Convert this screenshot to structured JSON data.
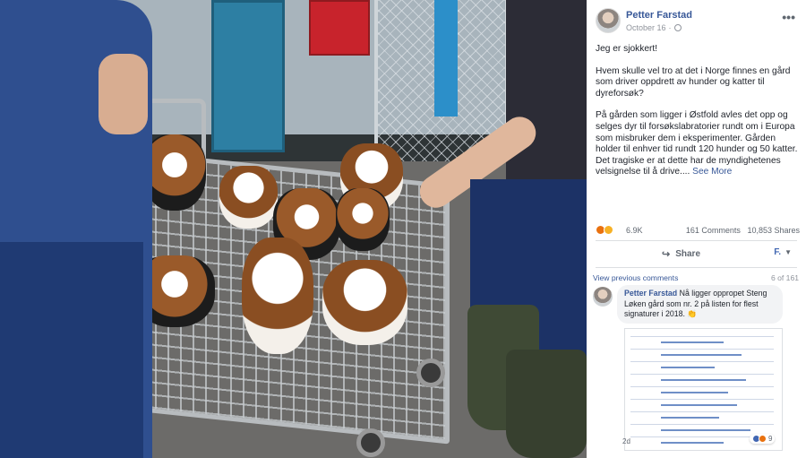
{
  "post": {
    "author": "Petter Farstad",
    "date": "October 16",
    "separator": "·",
    "paragraphs": [
      "Jeg er sjokkert!",
      "Hvem skulle vel tro at det i Norge finnes en gård som driver oppdrett av hunder og katter til dyreforsøk?",
      "På gården som ligger i Østfold avles det opp og selges dyr til forsøkslabratorier rundt om i Europa som misbruker dem i eksperimenter. Gården holder til enhver tid rundt 120 hunder og 50 katter. Det tragiske er at dette har de myndighetenes velsignelse til å drive...."
    ],
    "see_more": "See More",
    "reaction_count": "6.9K",
    "comments_count": "161 Comments",
    "shares_count": "10,853 Shares",
    "share_label": "Share",
    "page_selector": "F.",
    "reaction_icons": [
      "angry-icon",
      "sad-icon",
      "like-icon"
    ]
  },
  "comments": {
    "view_previous": "View previous comments",
    "position": "6 of 161",
    "items": [
      {
        "author": "Petter Farstad",
        "text": "Nå ligger oppropet Steng Løken gård som nr. 2 på listen for flest signaturer i 2018. 👏",
        "time": "2d",
        "reaction_count": "9"
      }
    ]
  },
  "colors": {
    "link": "#385898",
    "meta": "#90949c",
    "text": "#1d2129",
    "bubble": "#f2f3f5"
  }
}
